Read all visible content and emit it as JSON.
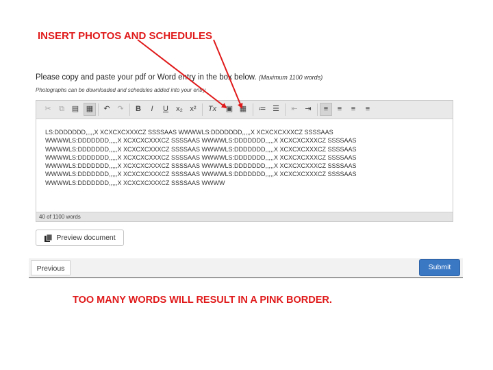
{
  "annotations": {
    "top_title": "INSERT PHOTOS AND SCHEDULES",
    "bottom_note": "TOO MANY WORDS WILL RESULT IN A PINK BORDER.",
    "arrow_color": "#e0191a"
  },
  "form": {
    "instruction": "Please copy and paste your pdf or Word entry in the box below.",
    "instruction_note": "(Maximum 1100 words)",
    "sub_instruction": "Photographs can be downloaded and schedules added into your entry"
  },
  "editor": {
    "toolbar_icons": [
      {
        "name": "cut-icon",
        "glyph": "✂"
      },
      {
        "name": "copy-icon",
        "glyph": "⧉"
      },
      {
        "name": "paste-icon",
        "glyph": "▤"
      },
      {
        "name": "paste-text-icon",
        "glyph": "▦"
      },
      {
        "name": "undo-icon",
        "glyph": "↶"
      },
      {
        "name": "redo-icon",
        "glyph": "↷"
      },
      {
        "name": "bold-icon",
        "glyph": "B"
      },
      {
        "name": "italic-icon",
        "glyph": "I"
      },
      {
        "name": "underline-icon",
        "glyph": "U"
      },
      {
        "name": "subscript-icon",
        "glyph": "x₂"
      },
      {
        "name": "superscript-icon",
        "glyph": "x²"
      },
      {
        "name": "remove-format-icon",
        "glyph": "Tx"
      },
      {
        "name": "insert-image-icon",
        "glyph": "▣"
      },
      {
        "name": "insert-table-icon",
        "glyph": "▦"
      },
      {
        "name": "numbered-list-icon",
        "glyph": "≔"
      },
      {
        "name": "bulleted-list-icon",
        "glyph": "☰"
      },
      {
        "name": "decrease-indent-icon",
        "glyph": "⇤"
      },
      {
        "name": "increase-indent-icon",
        "glyph": "⇥"
      },
      {
        "name": "align-left-icon",
        "glyph": "≡"
      },
      {
        "name": "align-center-icon",
        "glyph": "≡"
      },
      {
        "name": "align-right-icon",
        "glyph": "≡"
      },
      {
        "name": "justify-icon",
        "glyph": "≡"
      }
    ],
    "lines": [
      "LS:DDDDDDD,,,,,X XCXCXCXXXCZ SSSSAAS WWWWLS:DDDDDDD,,,,,X XCXCXCXXXCZ SSSSAAS",
      "WWWWLS:DDDDDDD,,,,,X XCXCXCXXXCZ SSSSAAS WWWWLS:DDDDDDD,,,,,X XCXCXCXXXCZ SSSSAAS",
      "WWWWLS:DDDDDDD,,,,,X XCXCXCXXXCZ SSSSAAS WWWWLS:DDDDDDD,,,,,X XCXCXCXXXCZ SSSSAAS",
      "WWWWLS:DDDDDDD,,,,,X XCXCXCXXXCZ SSSSAAS WWWWLS:DDDDDDD,,,,,X XCXCXCXXXCZ SSSSAAS",
      "WWWWLS:DDDDDDD,,,,,X XCXCXCXXXCZ SSSSAAS WWWWLS:DDDDDDD,,,,,X XCXCXCXXXCZ SSSSAAS",
      "WWWWLS:DDDDDDD,,,,,X XCXCXCXXXCZ SSSSAAS WWWWLS:DDDDDDD,,,,,X XCXCXCXXXCZ SSSSAAS",
      "WWWWLS:DDDDDDD,,,,,X XCXCXCXXXCZ SSSSAAS WWWW"
    ],
    "word_count": "40 of 1100 words"
  },
  "buttons": {
    "preview_label": "Preview document",
    "previous_label": "Previous",
    "submit_label": "Submit"
  }
}
